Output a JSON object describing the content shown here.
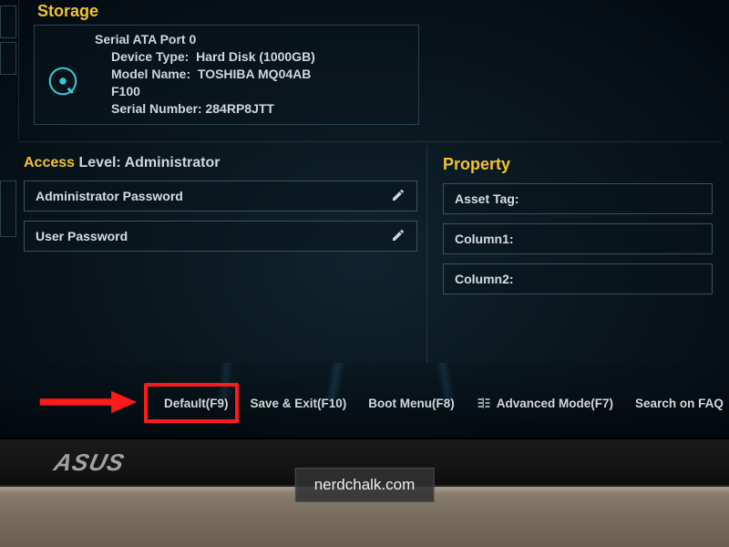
{
  "storage": {
    "title": "Storage",
    "port_label": "Serial ATA Port 0",
    "device_type_label": "Device Type:",
    "device_type_value": "Hard Disk (1000GB)",
    "model_name_label": "Model Name:",
    "model_name_value": "TOSHIBA MQ04AB",
    "model_name_value2": "F100",
    "serial_label": "Serial Number:",
    "serial_value": "284RP8JTT"
  },
  "access": {
    "heading_highlight": "Access",
    "heading_rest": "Level: Administrator",
    "admin_password_label": "Administrator Password",
    "user_password_label": "User Password"
  },
  "property": {
    "title": "Property",
    "asset_tag_label": "Asset Tag:",
    "column1_label": "Column1:",
    "column2_label": "Column2:"
  },
  "footer": {
    "default": "Default(F9)",
    "save_exit": "Save & Exit(F10)",
    "boot_menu": "Boot Menu(F8)",
    "advanced": "Advanced Mode(F7)",
    "search_faq": "Search on FAQ"
  },
  "branding": {
    "logo": "ASUS"
  },
  "watermark": {
    "text": "nerdchalk.com"
  }
}
